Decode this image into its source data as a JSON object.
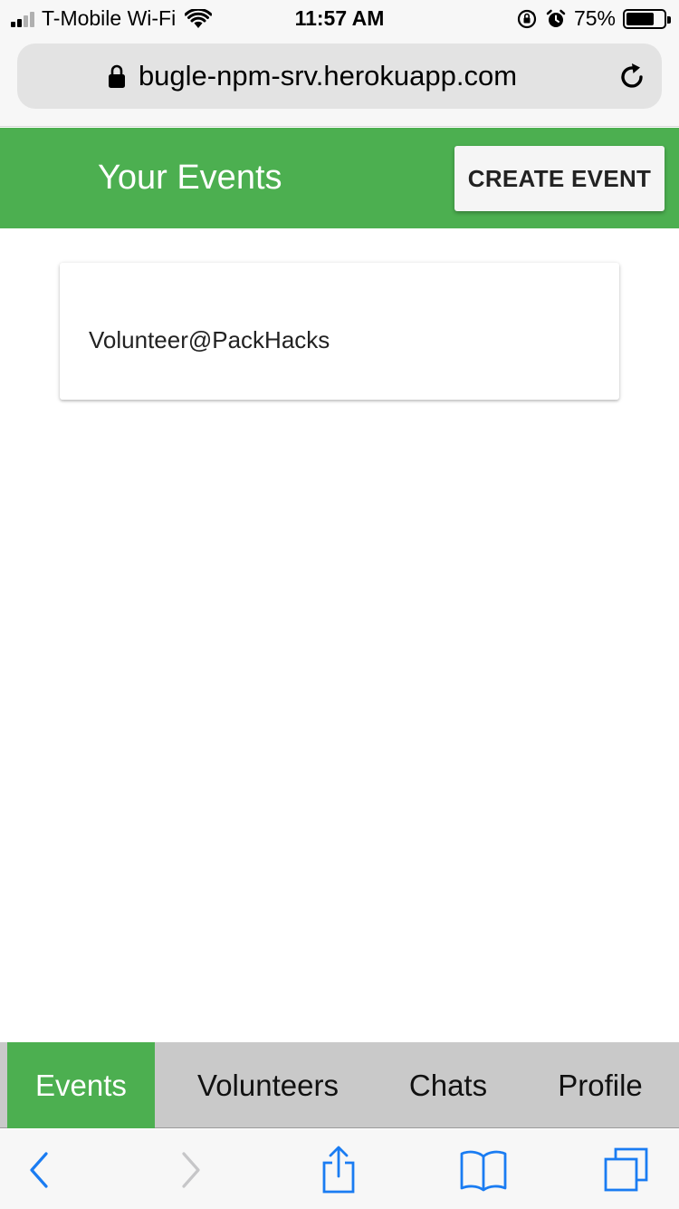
{
  "status_bar": {
    "carrier": "T-Mobile Wi-Fi",
    "time": "11:57 AM",
    "battery_percent_label": "75%",
    "battery_level": 0.75,
    "icons": [
      "signal-icon",
      "wifi-icon",
      "orientation-lock-icon",
      "alarm-icon",
      "battery-icon"
    ]
  },
  "browser": {
    "url": "bugle-npm-srv.herokuapp.com",
    "icons": [
      "lock-icon",
      "reload-icon"
    ],
    "toolbar_icons": [
      "back-icon",
      "forward-icon",
      "share-icon",
      "bookmarks-icon",
      "tabs-icon"
    ]
  },
  "header": {
    "title": "Your Events",
    "create_button": "CREATE EVENT",
    "color": "#4caf50"
  },
  "events": [
    {
      "name": "Volunteer@PackHacks"
    }
  ],
  "nav": {
    "items": [
      {
        "label": "Events",
        "active": true
      },
      {
        "label": "Volunteers",
        "active": false
      },
      {
        "label": "Chats",
        "active": false
      },
      {
        "label": "Profile",
        "active": false
      }
    ],
    "active_color": "#4caf50",
    "background": "#c9c9c9"
  }
}
